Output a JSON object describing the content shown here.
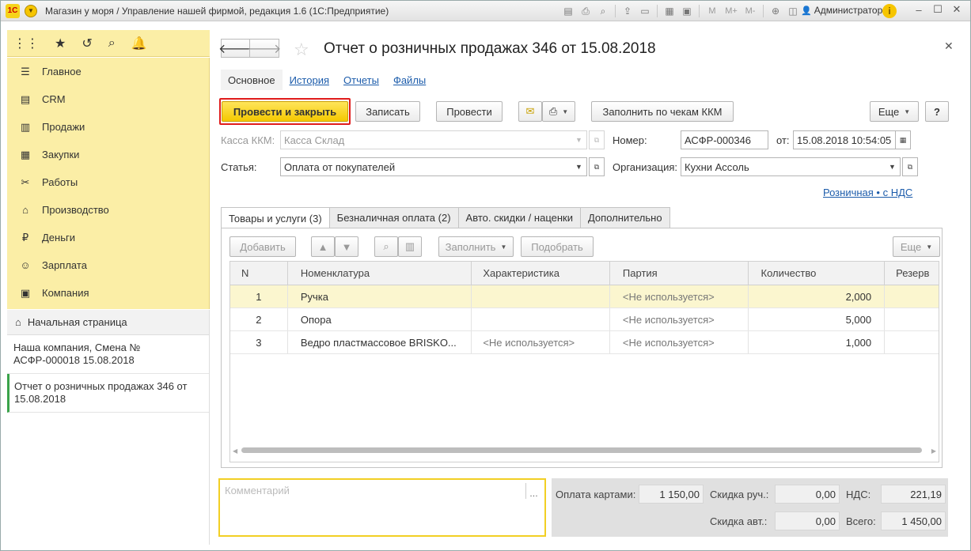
{
  "titlebar": {
    "logo": "1С",
    "title": "Магазин у моря / Управление нашей фирмой, редакция 1.6  (1С:Предприятие)",
    "m_buttons": [
      "M",
      "M+",
      "M-"
    ],
    "user": "Администратор"
  },
  "sidebar": {
    "items": [
      {
        "label": "Главное",
        "icon": "list-icon"
      },
      {
        "label": "CRM",
        "icon": "card-icon"
      },
      {
        "label": "Продажи",
        "icon": "cart-icon"
      },
      {
        "label": "Закупки",
        "icon": "basket-icon"
      },
      {
        "label": "Работы",
        "icon": "wrench-icon"
      },
      {
        "label": "Производство",
        "icon": "factory-icon"
      },
      {
        "label": "Деньги",
        "icon": "ruble-icon"
      },
      {
        "label": "Зарплата",
        "icon": "person-icon"
      },
      {
        "label": "Компания",
        "icon": "briefcase-icon"
      }
    ],
    "home": "Начальная страница",
    "open_windows": [
      "Наша компания, Смена № АСФР-000018  15.08.2018",
      "Отчет о розничных продажах 346 от 15.08.2018"
    ]
  },
  "form": {
    "title": "Отчет о розничных продажах 346 от 15.08.2018",
    "tabs": [
      "Основное",
      "История",
      "Отчеты",
      "Файлы"
    ],
    "toolbar": {
      "post_close": "Провести и закрыть",
      "save": "Записать",
      "post": "Провести",
      "fill": "Заполнить по чекам ККМ",
      "more": "Еще",
      "help": "?"
    },
    "fields": {
      "kassa_label": "Касса ККМ:",
      "kassa_value": "Касса Склад",
      "number_label": "Номер:",
      "number_value": "АСФР-000346",
      "date_label": "от:",
      "date_value": "15.08.2018 10:54:05",
      "statya_label": "Статья:",
      "statya_value": "Оплата от покупателей",
      "org_label": "Организация:",
      "org_value": "Кухни Ассоль",
      "tax_link": "Розничная • с НДС"
    },
    "table_tabs": [
      "Товары и услуги (3)",
      "Безналичная оплата (2)",
      "Авто. скидки / наценки",
      "Дополнительно"
    ],
    "table_toolbar": {
      "add": "Добавить",
      "fill": "Заполнить",
      "pick": "Подобрать",
      "more": "Еще"
    },
    "columns": [
      "N",
      "Номенклатура",
      "Характеристика",
      "Партия",
      "Количество",
      "Резерв"
    ],
    "rows": [
      {
        "n": "1",
        "item": "Ручка",
        "char": "",
        "batch": "<Не используется>",
        "qty": "2,000"
      },
      {
        "n": "2",
        "item": "Опора",
        "char": "",
        "batch": "<Не используется>",
        "qty": "5,000"
      },
      {
        "n": "3",
        "item": "Ведро пластмассовое BRISKO...",
        "char": "<Не используется>",
        "batch": "<Не используется>",
        "qty": "1,000"
      }
    ],
    "comment_placeholder": "Комментарий",
    "totals": {
      "card_label": "Оплата картами:",
      "card_value": "1 150,00",
      "disc_manual_label": "Скидка руч.:",
      "disc_manual_value": "0,00",
      "vat_label": "НДС:",
      "vat_value": "221,19",
      "disc_auto_label": "Скидка авт.:",
      "disc_auto_value": "0,00",
      "total_label": "Всего:",
      "total_value": "1 450,00"
    }
  },
  "colors": {
    "accent_yellow": "#f4c800",
    "sidebar_bg": "#fbeea6",
    "link_blue": "#1c5cab",
    "highlight_red": "#e01c1c"
  }
}
